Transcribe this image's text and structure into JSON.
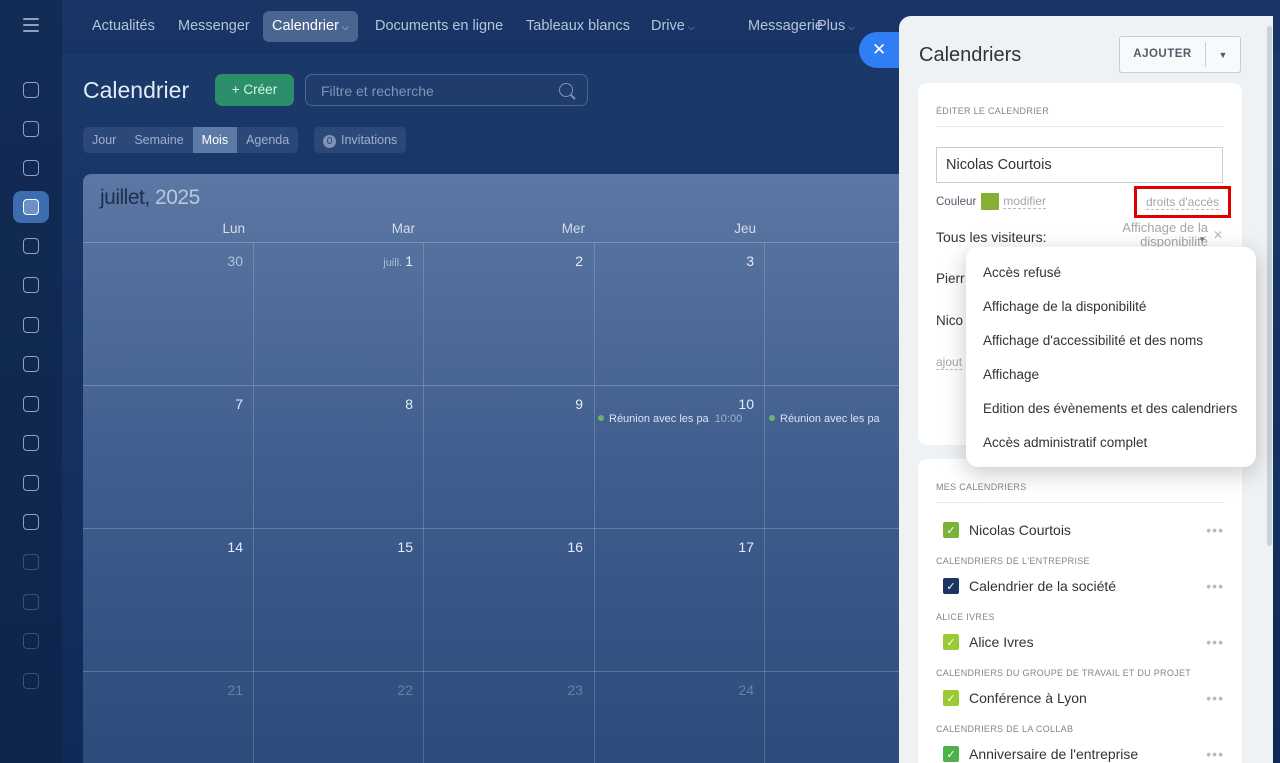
{
  "topnav": {
    "items": [
      {
        "label": "Actualités"
      },
      {
        "label": "Messenger"
      },
      {
        "label": "Calendrier",
        "active": true
      },
      {
        "label": "Documents en ligne"
      },
      {
        "label": "Tableaux blancs"
      },
      {
        "label": "Drive"
      },
      {
        "label": "Messagerie"
      },
      {
        "label": "Plus"
      }
    ]
  },
  "header": {
    "title": "Calendrier",
    "create_label": "+ Créer",
    "search_placeholder": "Filtre et recherche"
  },
  "viewtabs": [
    "Jour",
    "Semaine",
    "Mois",
    "Agenda"
  ],
  "invitations": {
    "count": "0",
    "label": "Invitations"
  },
  "calendar": {
    "month": "juillet,",
    "year": "2025",
    "weekdays": [
      "Lun",
      "Mar",
      "Mer",
      "Jeu"
    ],
    "week1": [
      "30",
      "1",
      "2",
      "3"
    ],
    "week1_month_prefix": "juill.",
    "week2": [
      "7",
      "8",
      "9",
      "10"
    ],
    "week3": [
      "14",
      "15",
      "16",
      "17"
    ],
    "week4": [
      "21",
      "22",
      "23",
      "24"
    ],
    "events": [
      {
        "title": "Réunion avec les pa",
        "time": "10:00"
      },
      {
        "title": "Réunion avec les pa"
      }
    ]
  },
  "panel": {
    "title": "Calendriers",
    "add_label": "AJOUTER",
    "edit_section": "ÉDITER LE CALENDRIER",
    "calendar_name": "Nicolas Courtois",
    "color_label": "Couleur",
    "modify_link": "modifier",
    "access_rights_link": "droits d'accès",
    "color": "#86b034",
    "visitors_label": "Tous les visiteurs:",
    "visitors_value": "Affichage de la disponibilité",
    "truncated_rows": [
      "Pierr",
      "Nico"
    ],
    "add_access": "ajout",
    "my_calendars_section": "MES CALENDRIERS",
    "groups": [
      {
        "heading": "",
        "name": "Nicolas Courtois",
        "color": "#7ab33a"
      },
      {
        "heading": "CALENDRIERS DE L'ENTREPRISE",
        "name": "Calendrier de la société",
        "color": "#1d3460"
      },
      {
        "heading": "ALICE IVRES",
        "name": "Alice Ivres",
        "color": "#9acb34"
      },
      {
        "heading": "CALENDRIERS DU GROUPE DE TRAVAIL ET DU PROJET",
        "name": "Conférence à Lyon",
        "color": "#9acb34"
      },
      {
        "heading": "CALENDRIERS DE LA COLLAB",
        "name": "Anniversaire de l'entreprise",
        "color": "#4cb34a"
      }
    ]
  },
  "access_menu": {
    "options": [
      "Accès refusé",
      "Affichage de la disponibilité",
      "Affichage d'accessibilité et des noms",
      "Affichage",
      "Edition des évènements et des calendriers",
      "Accès administratif complet"
    ]
  }
}
